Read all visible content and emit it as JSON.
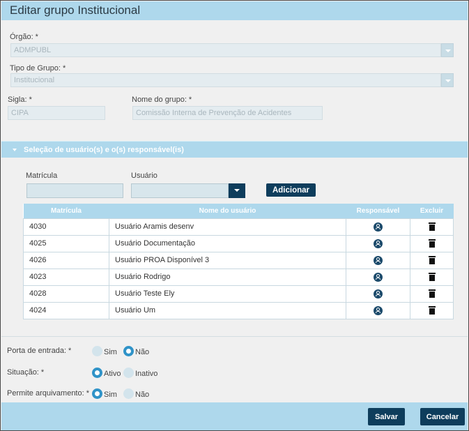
{
  "dialog": {
    "title": "Editar grupo Institucional"
  },
  "form": {
    "orgao": {
      "label": "Órgão: *",
      "value": "ADMPUBL"
    },
    "tipo_grupo": {
      "label": "Tipo de Grupo: *",
      "value": "Institucional"
    },
    "sigla": {
      "label": "Sigla: *",
      "value": "CIPA"
    },
    "nome_grupo": {
      "label": "Nome do grupo: *",
      "value": "Comissão Interna de Prevenção de Acidentes"
    }
  },
  "section": {
    "title": "Seleção de usuário(s) e o(s) responsável(is)",
    "matricula_label": "Matrícula",
    "usuario_label": "Usuário",
    "add_label": "Adicionar"
  },
  "table": {
    "headers": {
      "matricula": "Matrícula",
      "nome": "Nome do usuário",
      "responsavel": "Responsável",
      "excluir": "Excluir"
    },
    "rows": [
      {
        "matricula": "4030",
        "nome": "Usuário Aramis desenv"
      },
      {
        "matricula": "4025",
        "nome": "Usuário Documentação"
      },
      {
        "matricula": "4026",
        "nome": "Usuário PROA Disponível 3"
      },
      {
        "matricula": "4023",
        "nome": "Usuário Rodrigo"
      },
      {
        "matricula": "4028",
        "nome": "Usuário Teste Ely"
      },
      {
        "matricula": "4024",
        "nome": "Usuário Um"
      }
    ]
  },
  "options": {
    "porta_entrada": {
      "label": "Porta de entrada: *",
      "opt1": "Sim",
      "opt2": "Não",
      "selected": "Não"
    },
    "situacao": {
      "label": "Situação: *",
      "opt1": "Ativo",
      "opt2": "Inativo",
      "selected": "Ativo"
    },
    "arquivamento": {
      "label": "Permite arquivamento: *",
      "opt1": "Sim",
      "opt2": "Não",
      "selected": "Sim"
    }
  },
  "footer": {
    "save_label": "Salvar",
    "cancel_label": "Cancelar"
  },
  "colors": {
    "accent": "#aed8ec",
    "dark_button": "#0e3d5c",
    "radio_selected": "#2f93c8"
  }
}
